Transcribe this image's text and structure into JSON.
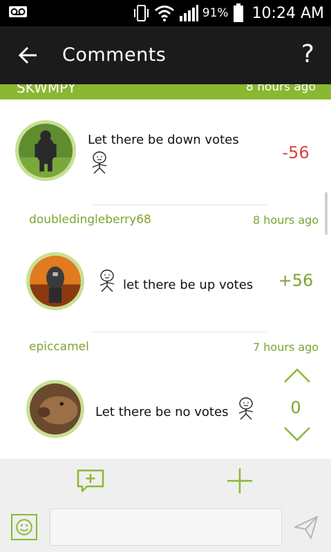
{
  "status_bar": {
    "battery_percent": "91%",
    "time": "10:24 AM",
    "icons": [
      "voicemail-icon",
      "vibrate-icon",
      "wifi-icon",
      "signal-icon",
      "battery-icon"
    ]
  },
  "app_bar": {
    "title": "Comments",
    "help": "?"
  },
  "partial_comment": {
    "user": "SKWMPY",
    "time": "8 hours ago"
  },
  "comments": [
    {
      "avatar": "gorilla-avatar",
      "text": "Let there be down votes",
      "score": "-56"
    },
    {
      "user": "doubledingleberry68",
      "time": "8 hours ago",
      "avatar": "warrior-avatar",
      "text": "let there be up votes",
      "score": "+56"
    },
    {
      "user": "epiccamel",
      "time": "7 hours ago",
      "avatar": "camel-avatar",
      "text": "Let there be no votes",
      "score": "0"
    }
  ],
  "colors": {
    "accent": "#8ab832",
    "accent_text": "#7ea331",
    "negative": "#d5443e",
    "app_bar": "#1b1b1b"
  },
  "input": {
    "value": "",
    "placeholder": ""
  }
}
